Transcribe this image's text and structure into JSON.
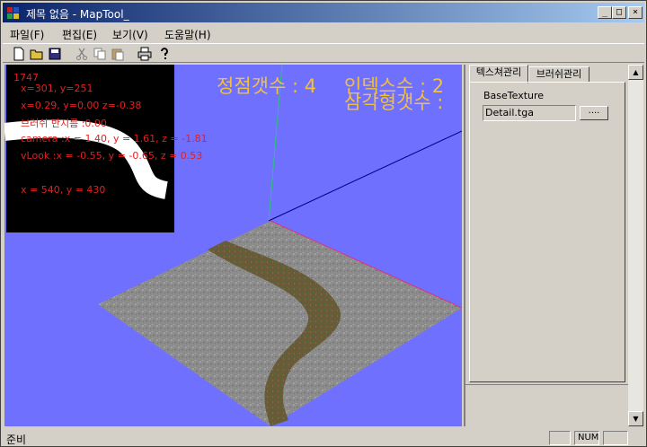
{
  "window": {
    "title": "제목 없음 - MapTool_",
    "controls": {
      "minimize": "_",
      "maximize": "□",
      "close": "×"
    }
  },
  "menu": [
    {
      "label": "파일(F)"
    },
    {
      "label": "편집(E)"
    },
    {
      "label": "보기(V)"
    },
    {
      "label": "도움말(H)"
    }
  ],
  "toolbar": {
    "icons": [
      "new-file-icon",
      "open-folder-icon",
      "save-icon",
      "cut-icon",
      "copy-icon",
      "paste-icon",
      "print-icon",
      "help-icon"
    ]
  },
  "viewport": {
    "debug_lines": [
      "1747",
      "x=301, y=251",
      "x=0.29, y=0.00 z=-0.38",
      "브러쉬 반지름 :0.00",
      "camera :x = 1.40, y = 1.61, z = -1.81",
      "vLook :x = -0.55, y = -0.65, z = 0.53",
      "x = 540, y = 430"
    ],
    "vertex_count": "정점갯수 : 4",
    "index_count": "인덱스수 : 2",
    "triangle_count": "삼각형갯수 : "
  },
  "panel": {
    "tabs": [
      {
        "label": "텍스쳐관리",
        "active": true
      },
      {
        "label": "브러쉬관리",
        "active": false
      }
    ],
    "base_texture_label": "BaseTexture",
    "base_texture_value": "Detail.tga",
    "browse_label": "...."
  },
  "status": {
    "text": "준비",
    "num": "NUM"
  },
  "colors": {
    "title_start": "#0a246a",
    "title_end": "#a6caf0",
    "viewport_bg": "#7070ff",
    "debug_text": "#e02020",
    "stats_text": "#f0c040"
  }
}
